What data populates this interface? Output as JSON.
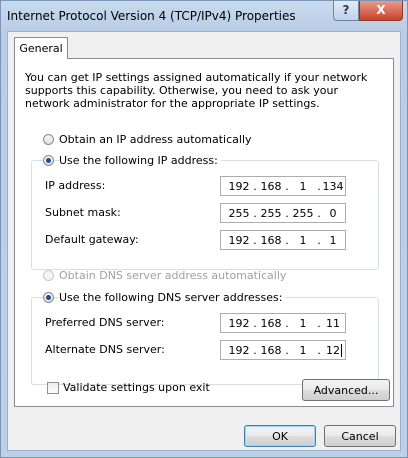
{
  "window": {
    "title": "Internet Protocol Version 4 (TCP/IPv4) Properties",
    "help_glyph": "?",
    "close_glyph": "X"
  },
  "tab": {
    "label": "General"
  },
  "intro": "You can get IP settings assigned automatically if your network supports this capability. Otherwise, you need to ask your network administrator for the appropriate IP settings.",
  "ip": {
    "auto_label": "Obtain an IP address automatically",
    "manual_label": "Use the following IP address:",
    "selected": "manual",
    "address_label": "IP address:",
    "address": [
      "192",
      "168",
      "1",
      "134"
    ],
    "subnet_label": "Subnet mask:",
    "subnet": [
      "255",
      "255",
      "255",
      "0"
    ],
    "gateway_label": "Default gateway:",
    "gateway": [
      "192",
      "168",
      "1",
      "1"
    ]
  },
  "dns": {
    "auto_label": "Obtain DNS server address automatically",
    "manual_label": "Use the following DNS server addresses:",
    "selected": "manual",
    "preferred_label": "Preferred DNS server:",
    "preferred": [
      "192",
      "168",
      "1",
      "11"
    ],
    "alternate_label": "Alternate DNS server:",
    "alternate": [
      "192",
      "168",
      "1",
      "12"
    ]
  },
  "validate": {
    "label": "Validate settings upon exit",
    "checked": false
  },
  "buttons": {
    "advanced": "Advanced...",
    "ok": "OK",
    "cancel": "Cancel"
  },
  "separator": "."
}
